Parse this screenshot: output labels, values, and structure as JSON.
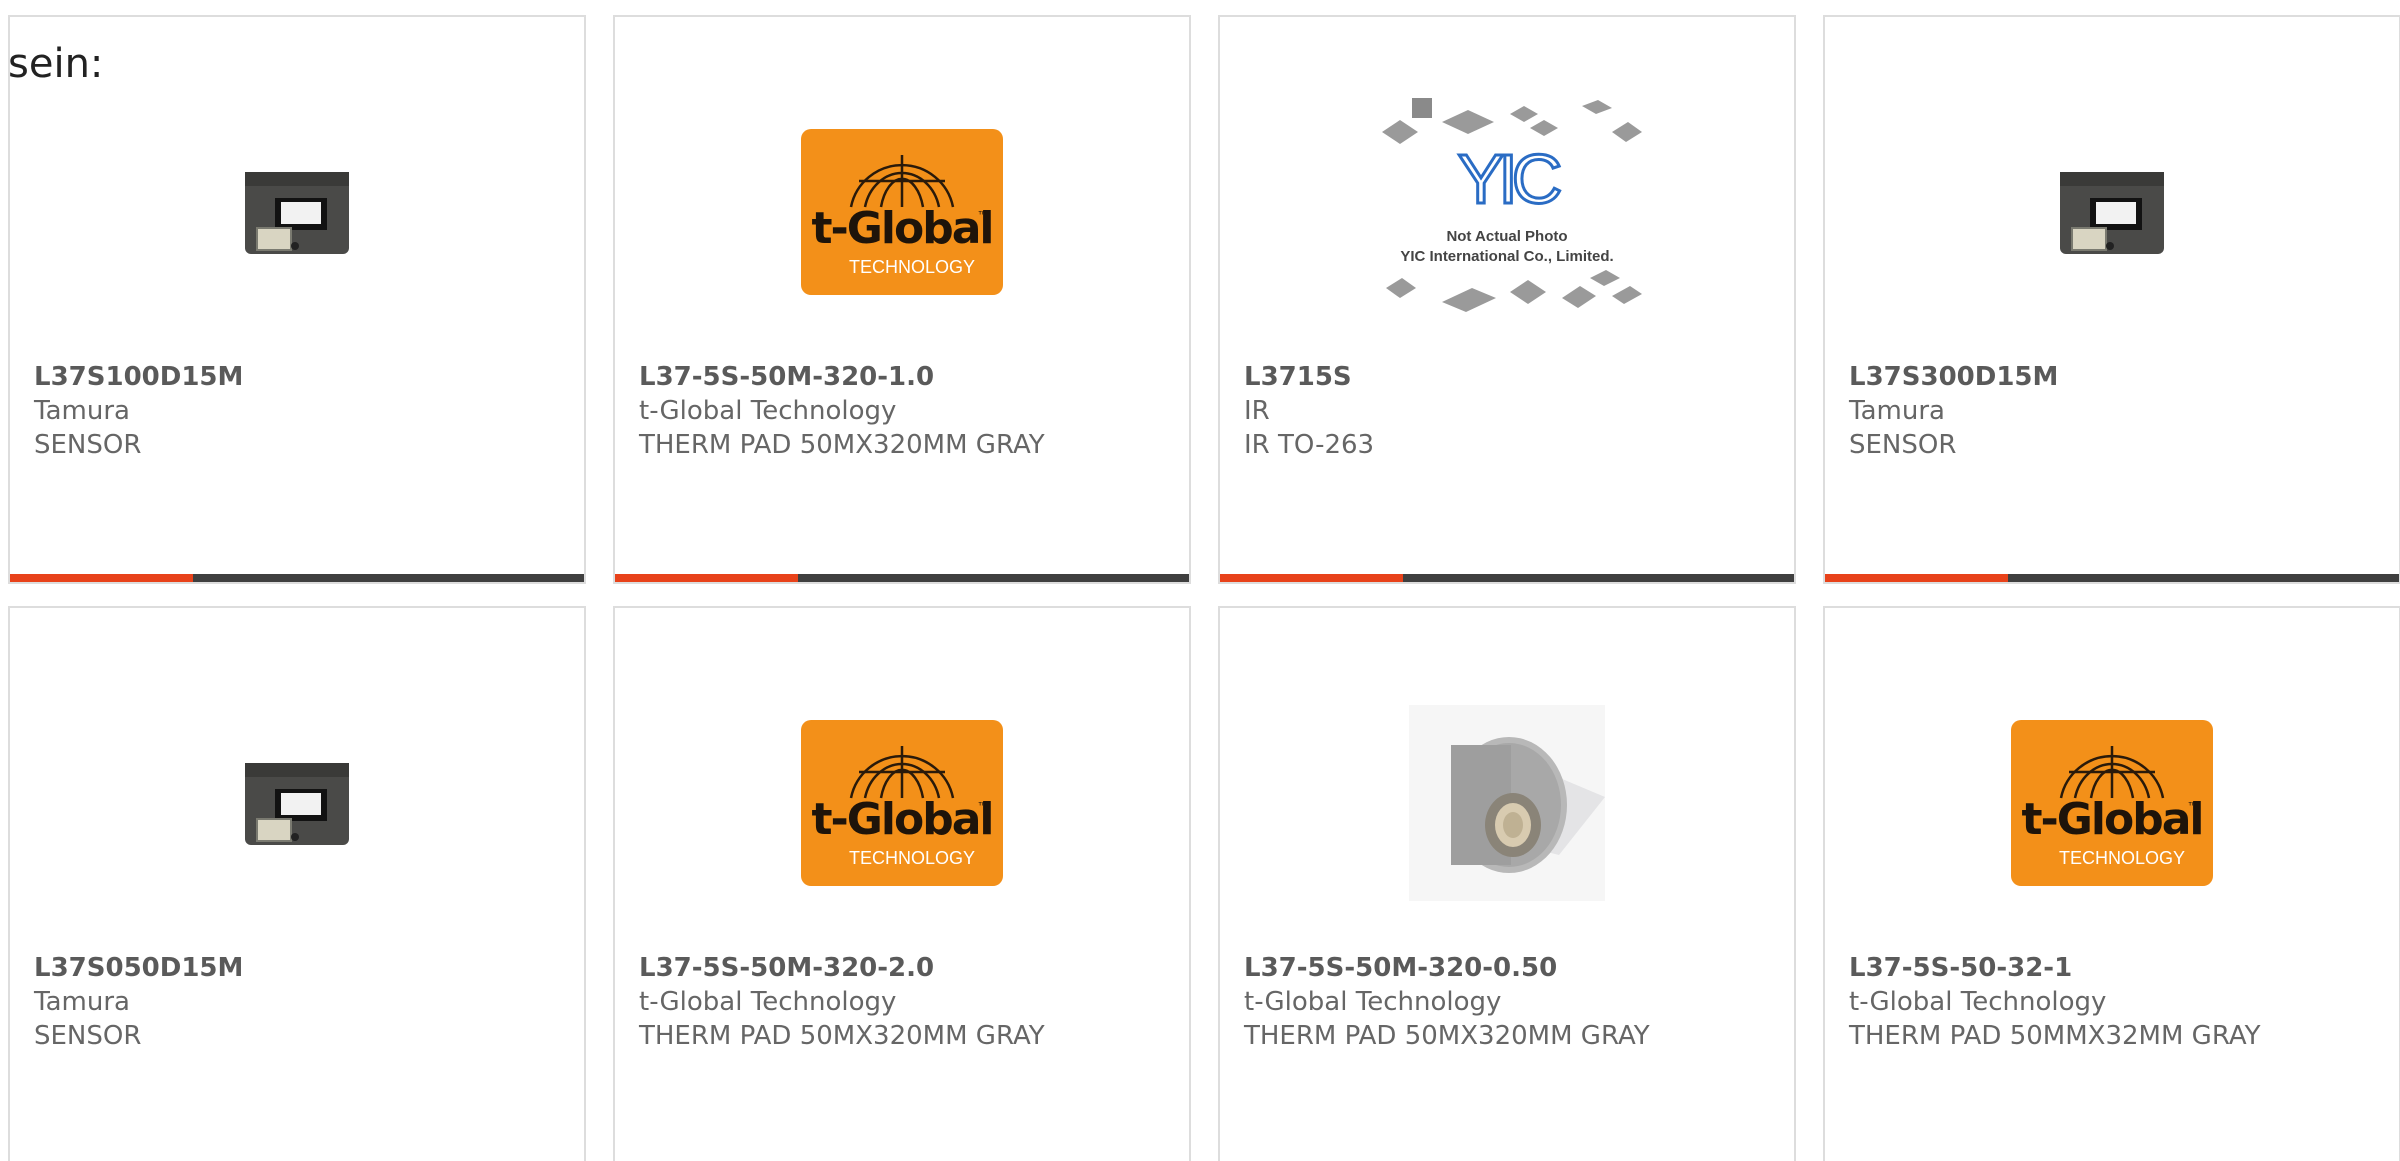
{
  "intro_text": "sein:",
  "accent_color": "#e8421a",
  "products": [
    {
      "part_number": "L37S100D15M",
      "manufacturer": "Tamura",
      "description": "SENSOR",
      "image": "current-sensor-photo"
    },
    {
      "part_number": "L37-5S-50M-320-1.0",
      "manufacturer": "t-Global Technology",
      "description": "THERM PAD 50MX320MM GRAY",
      "image": "t-global-logo"
    },
    {
      "part_number": "L3715S",
      "manufacturer": "IR",
      "description": "IR TO-263",
      "image": "yic-placeholder",
      "placeholder_brand": "YIC",
      "placeholder_line1": "Not Actual Photo",
      "placeholder_line2": "YIC International Co., Limited."
    },
    {
      "part_number": "L37S300D15M",
      "manufacturer": "Tamura",
      "description": "SENSOR",
      "image": "current-sensor-photo"
    },
    {
      "part_number": "L37S050D15M",
      "manufacturer": "Tamura",
      "description": "SENSOR",
      "image": "current-sensor-photo"
    },
    {
      "part_number": "L37-5S-50M-320-2.0",
      "manufacturer": "t-Global Technology",
      "description": "THERM PAD 50MX320MM GRAY",
      "image": "t-global-logo"
    },
    {
      "part_number": "L37-5S-50M-320-0.50",
      "manufacturer": "t-Global Technology",
      "description": "THERM PAD 50MX320MM GRAY",
      "image": "thermal-pad-roll-photo"
    },
    {
      "part_number": "L37-5S-50-32-1",
      "manufacturer": "t-Global Technology",
      "description": "THERM PAD 50MMX32MM GRAY",
      "image": "t-global-logo"
    }
  ],
  "logo": {
    "brand_word": "t-Global",
    "tm": "™",
    "sub": "TECHNOLOGY"
  }
}
